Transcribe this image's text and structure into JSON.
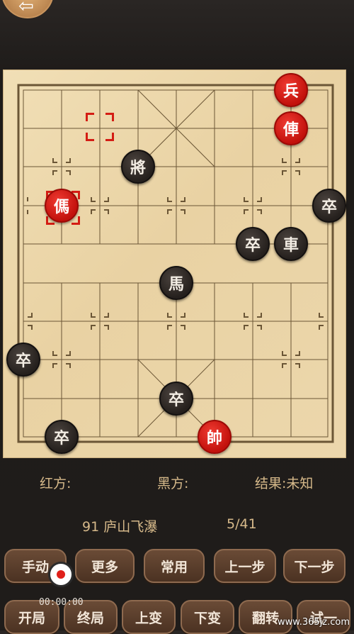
{
  "top_bar": {
    "back_icon": "back-arrow-icon",
    "back_glyph": "⇦"
  },
  "pieces": [
    {
      "id": "red-bing",
      "label": "兵",
      "side": "red"
    },
    {
      "id": "red-ju",
      "label": "俥",
      "side": "red"
    },
    {
      "id": "black-jiang",
      "label": "將",
      "side": "black"
    },
    {
      "id": "red-xiang",
      "label": "傌",
      "side": "red",
      "selected": true
    },
    {
      "id": "black-zu-edge",
      "label": "卒",
      "side": "black"
    },
    {
      "id": "black-zu-1",
      "label": "卒",
      "side": "black"
    },
    {
      "id": "black-ju",
      "label": "車",
      "side": "black"
    },
    {
      "id": "black-ma",
      "label": "馬",
      "side": "black"
    },
    {
      "id": "black-zu-2",
      "label": "卒",
      "side": "black"
    },
    {
      "id": "black-zu-3",
      "label": "卒",
      "side": "black"
    },
    {
      "id": "black-zu-4",
      "label": "卒",
      "side": "black"
    },
    {
      "id": "red-shuai",
      "label": "帥",
      "side": "red"
    }
  ],
  "info": {
    "red_label": "红方:",
    "black_label": "黑方:",
    "result_label": "结果:未知",
    "puzzle_name": "91 庐山飞瀑",
    "progress": "5/41"
  },
  "buttons_row1": [
    "手动",
    "更多",
    "常用",
    "上一步",
    "下一步"
  ],
  "buttons_row2": [
    "开局",
    "终局",
    "上变",
    "下变",
    "翻转",
    "试一"
  ],
  "recording": {
    "time": "00:00:00"
  },
  "watermark": "www.365jz.com"
}
